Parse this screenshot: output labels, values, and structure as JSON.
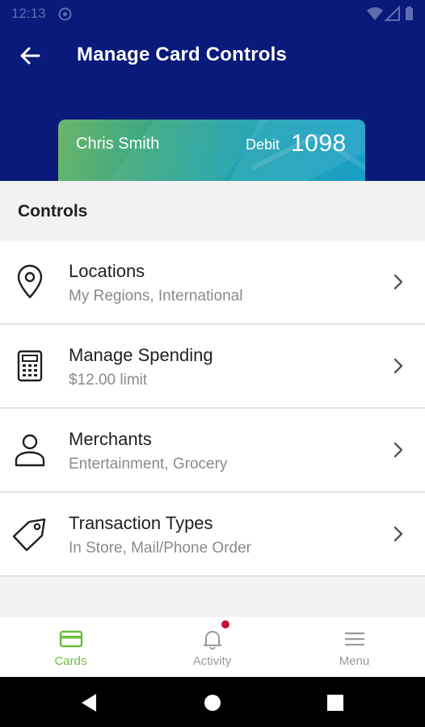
{
  "status_bar": {
    "time": "12:13",
    "icons": [
      "at-sign-icon",
      "wifi-icon",
      "signal-icon",
      "battery-icon"
    ]
  },
  "header": {
    "title": "Manage Card Controls",
    "back_icon": "arrow-left-icon",
    "background_color": "#0a1a7a"
  },
  "card": {
    "holder_name": "Chris Smith",
    "type": "Debit",
    "last4": "1098"
  },
  "controls": {
    "section_title": "Controls",
    "items": [
      {
        "title": "Locations",
        "subtitle": "My Regions, International",
        "icon": "location-pin-icon"
      },
      {
        "title": "Manage Spending",
        "subtitle": "$12.00 limit",
        "icon": "calculator-icon"
      },
      {
        "title": "Merchants",
        "subtitle": "Entertainment, Grocery",
        "icon": "person-icon"
      },
      {
        "title": "Transaction Types",
        "subtitle": "In Store, Mail/Phone Order",
        "icon": "tag-icon"
      }
    ]
  },
  "bottom_nav": {
    "items": [
      {
        "label": "Cards",
        "icon": "card-icon",
        "active": true
      },
      {
        "label": "Activity",
        "icon": "bell-icon",
        "active": false,
        "has_badge": true
      },
      {
        "label": "Menu",
        "icon": "hamburger-menu-icon",
        "active": false
      }
    ],
    "active_color": "#6cbf3c",
    "badge_color": "#c8102e"
  },
  "system_nav": {
    "icons": [
      "back-triangle-icon",
      "home-circle-icon",
      "recents-square-icon"
    ]
  }
}
